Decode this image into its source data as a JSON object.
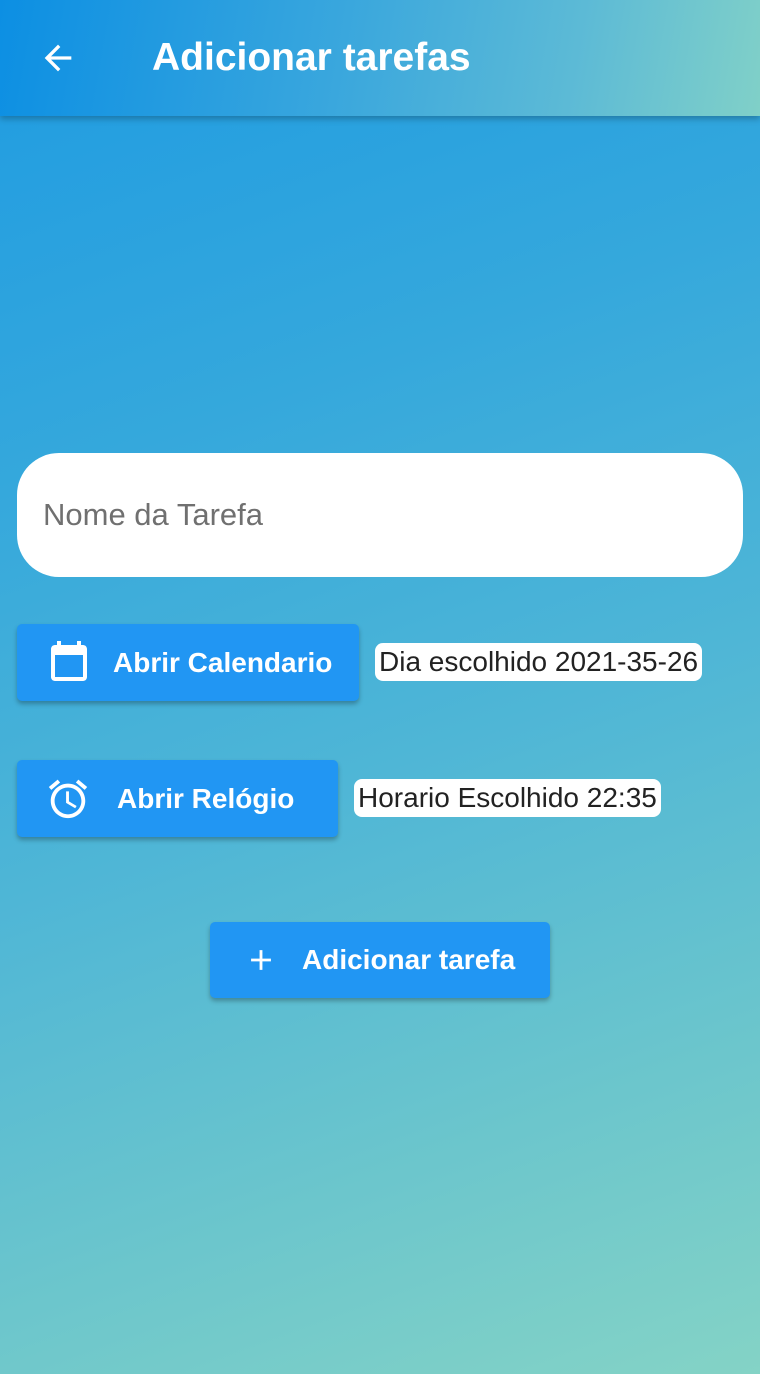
{
  "appbar": {
    "title": "Adicionar tarefas",
    "back_icon": "arrow-back-icon"
  },
  "form": {
    "task_name": {
      "value": "",
      "placeholder": "Nome da Tarefa"
    },
    "calendar_button": {
      "label": "Abrir Calendario",
      "icon": "calendar-icon"
    },
    "selected_date_text": "Dia escolhido 2021-35-26",
    "clock_button": {
      "label": "Abrir Relógio",
      "icon": "alarm-clock-icon"
    },
    "selected_time_text": "Horario Escolhido 22:35",
    "add_button": {
      "label": "Adicionar tarefa",
      "icon": "plus-icon"
    }
  },
  "colors": {
    "button": "#2196f3",
    "appbar_start": "#0c8fe3",
    "appbar_end": "#80d0c8",
    "background_top": "#1e9be2",
    "background_bottom": "#84d3c6"
  }
}
